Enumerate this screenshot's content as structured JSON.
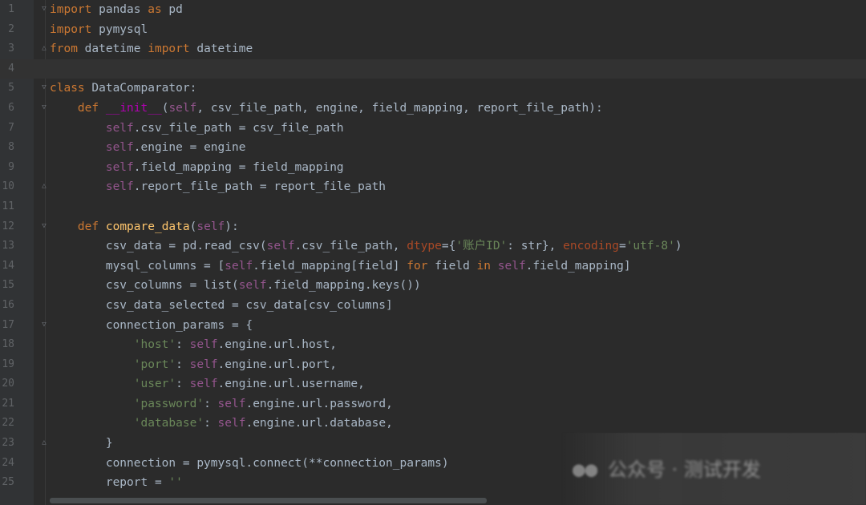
{
  "editor": {
    "colors": {
      "background": "#2b2b2b",
      "gutter": "#313335",
      "line_number": "#606366",
      "current_line": "#323232",
      "plain": "#a9b7c6",
      "keyword": "#cc7832",
      "self": "#94558d",
      "magic": "#b200b2",
      "function": "#ffc66d",
      "string": "#6a8759",
      "param": "#aa4926"
    },
    "current_line": 4,
    "lines": [
      {
        "n": "1",
        "fold": "open",
        "tokens": [
          [
            "keyword",
            "import"
          ],
          [
            "plain",
            " pandas "
          ],
          [
            "keyword",
            "as"
          ],
          [
            "plain",
            " pd"
          ]
        ]
      },
      {
        "n": "2",
        "tokens": [
          [
            "keyword",
            "import"
          ],
          [
            "plain",
            " pymysql"
          ]
        ]
      },
      {
        "n": "3",
        "fold": "close",
        "tokens": [
          [
            "keyword",
            "from"
          ],
          [
            "plain",
            " datetime "
          ],
          [
            "keyword",
            "import"
          ],
          [
            "plain",
            " datetime"
          ]
        ]
      },
      {
        "n": "4",
        "tokens": []
      },
      {
        "n": "5",
        "fold": "open",
        "tokens": [
          [
            "keyword",
            "class"
          ],
          [
            "plain",
            " DataComparator:"
          ]
        ]
      },
      {
        "n": "6",
        "fold": "open",
        "tokens": [
          [
            "plain",
            "    "
          ],
          [
            "keyword",
            "def"
          ],
          [
            "plain",
            " "
          ],
          [
            "magic",
            "__init__"
          ],
          [
            "plain",
            "("
          ],
          [
            "self",
            "self"
          ],
          [
            "plain",
            ", csv_file_path, engine, field_mapping, report_file_path):"
          ]
        ]
      },
      {
        "n": "7",
        "tokens": [
          [
            "plain",
            "        "
          ],
          [
            "self",
            "self"
          ],
          [
            "plain",
            ".csv_file_path = csv_file_path"
          ]
        ]
      },
      {
        "n": "8",
        "tokens": [
          [
            "plain",
            "        "
          ],
          [
            "self",
            "self"
          ],
          [
            "plain",
            ".engine = engine"
          ]
        ]
      },
      {
        "n": "9",
        "tokens": [
          [
            "plain",
            "        "
          ],
          [
            "self",
            "self"
          ],
          [
            "plain",
            ".field_mapping = field_mapping"
          ]
        ]
      },
      {
        "n": "10",
        "fold": "close",
        "tokens": [
          [
            "plain",
            "        "
          ],
          [
            "self",
            "self"
          ],
          [
            "plain",
            ".report_file_path = report_file_path"
          ]
        ]
      },
      {
        "n": "11",
        "tokens": []
      },
      {
        "n": "12",
        "fold": "open",
        "tokens": [
          [
            "plain",
            "    "
          ],
          [
            "keyword",
            "def"
          ],
          [
            "plain",
            " "
          ],
          [
            "func",
            "compare_data"
          ],
          [
            "plain",
            "("
          ],
          [
            "self",
            "self"
          ],
          [
            "plain",
            "):"
          ]
        ]
      },
      {
        "n": "13",
        "tokens": [
          [
            "plain",
            "        csv_data = pd.read_csv("
          ],
          [
            "self",
            "self"
          ],
          [
            "plain",
            ".csv_file_path, "
          ],
          [
            "param",
            "dtype"
          ],
          [
            "plain",
            "={"
          ],
          [
            "string",
            "'账户ID'"
          ],
          [
            "plain",
            ": str}, "
          ],
          [
            "param",
            "encoding"
          ],
          [
            "plain",
            "="
          ],
          [
            "string",
            "'utf-8'"
          ],
          [
            "plain",
            ")"
          ]
        ]
      },
      {
        "n": "14",
        "tokens": [
          [
            "plain",
            "        mysql_columns = ["
          ],
          [
            "self",
            "self"
          ],
          [
            "plain",
            ".field_mapping[field] "
          ],
          [
            "keyword",
            "for"
          ],
          [
            "plain",
            " field "
          ],
          [
            "keyword",
            "in"
          ],
          [
            "plain",
            " "
          ],
          [
            "self",
            "self"
          ],
          [
            "plain",
            ".field_mapping]"
          ]
        ]
      },
      {
        "n": "15",
        "tokens": [
          [
            "plain",
            "        csv_columns = list("
          ],
          [
            "self",
            "self"
          ],
          [
            "plain",
            ".field_mapping.keys())"
          ]
        ]
      },
      {
        "n": "16",
        "tokens": [
          [
            "plain",
            "        csv_data_selected = csv_data[csv_columns]"
          ]
        ]
      },
      {
        "n": "17",
        "fold": "open",
        "tokens": [
          [
            "plain",
            "        connection_params = {"
          ]
        ]
      },
      {
        "n": "18",
        "tokens": [
          [
            "plain",
            "            "
          ],
          [
            "string",
            "'host'"
          ],
          [
            "plain",
            ": "
          ],
          [
            "self",
            "self"
          ],
          [
            "plain",
            ".engine.url.host,"
          ]
        ]
      },
      {
        "n": "19",
        "tokens": [
          [
            "plain",
            "            "
          ],
          [
            "string",
            "'port'"
          ],
          [
            "plain",
            ": "
          ],
          [
            "self",
            "self"
          ],
          [
            "plain",
            ".engine.url.port,"
          ]
        ]
      },
      {
        "n": "20",
        "tokens": [
          [
            "plain",
            "            "
          ],
          [
            "string",
            "'user'"
          ],
          [
            "plain",
            ": "
          ],
          [
            "self",
            "self"
          ],
          [
            "plain",
            ".engine.url.username,"
          ]
        ]
      },
      {
        "n": "21",
        "tokens": [
          [
            "plain",
            "            "
          ],
          [
            "string",
            "'password'"
          ],
          [
            "plain",
            ": "
          ],
          [
            "self",
            "self"
          ],
          [
            "plain",
            ".engine.url.password,"
          ]
        ]
      },
      {
        "n": "22",
        "tokens": [
          [
            "plain",
            "            "
          ],
          [
            "string",
            "'database'"
          ],
          [
            "plain",
            ": "
          ],
          [
            "self",
            "self"
          ],
          [
            "plain",
            ".engine.url.database,"
          ]
        ]
      },
      {
        "n": "23",
        "fold": "close",
        "tokens": [
          [
            "plain",
            "        }"
          ]
        ]
      },
      {
        "n": "24",
        "tokens": [
          [
            "plain",
            "        connection = pymysql.connect(**connection_params)"
          ]
        ]
      },
      {
        "n": "25",
        "tokens": [
          [
            "plain",
            "        report = "
          ],
          [
            "string",
            "''"
          ]
        ]
      }
    ]
  },
  "watermark": {
    "icon": "wechat-icon",
    "text": "公众号 · 测试开发"
  }
}
